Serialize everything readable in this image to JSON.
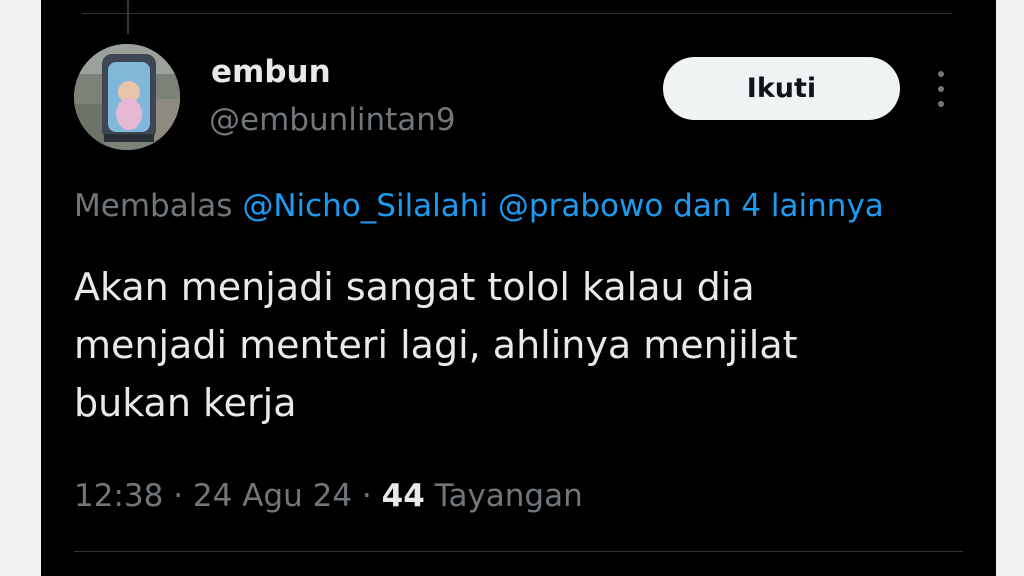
{
  "tweet": {
    "author": {
      "display_name": "embun",
      "handle": "@embunlintan9"
    },
    "follow_label": "Ikuti",
    "reply_context": {
      "prefix": "Membalas",
      "mention_1": "@Nicho_Silalahi",
      "mention_2": "@prabowo",
      "connector": "dan",
      "others": "4 lainnya"
    },
    "text_lines": [
      "Akan menjadi sangat tolol kalau dia",
      "menjadi menteri lagi, ahlinya menjilat",
      "bukan kerja"
    ],
    "meta": {
      "time": "12:38",
      "date": "24 Agu 24",
      "separator": "·",
      "views_count": "44",
      "views_label": "Tayangan"
    }
  },
  "icons": {
    "more": "more-vertical-icon"
  },
  "colors": {
    "background": "#000000",
    "primary_text": "#e7e9ea",
    "secondary_text": "#71767b",
    "accent": "#1d9bf0",
    "follow_button_bg": "#eff3f4",
    "divider": "#2f3336"
  }
}
